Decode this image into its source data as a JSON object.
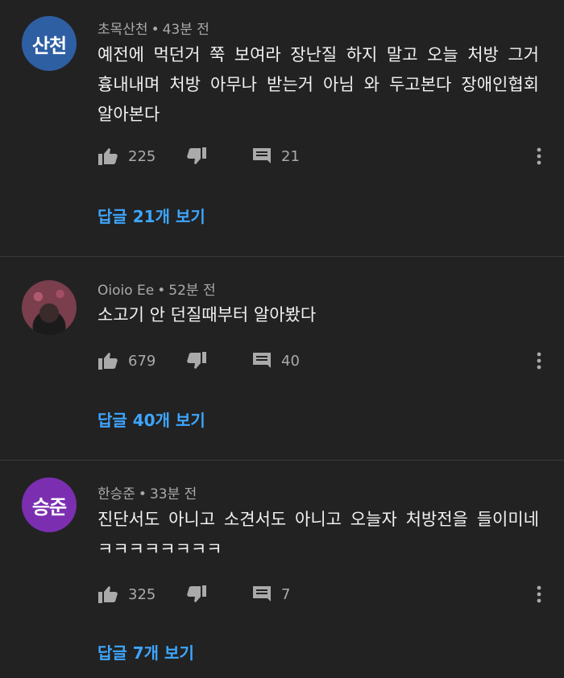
{
  "colors": {
    "background": "#222222",
    "text_primary": "#f1f1f1",
    "text_secondary": "#aaaaaa",
    "link": "#3ea6ff",
    "divider": "#3a3a3a"
  },
  "comments": [
    {
      "avatar_text": "산천",
      "avatar_color": "#2f5fa3",
      "author": "초목산천",
      "separator": "•",
      "time": "43분 전",
      "text": "예전에 먹던거 쭉 보여라 장난질 하지 말고 오늘 처방 그거 흉내내며 처방 아무나 받는거 아님 와 두고본다 장애인협회 알아본다",
      "likes": "225",
      "replies": "21",
      "view_replies": "답글 21개 보기",
      "icons": {
        "like": "thumbs-up-icon",
        "dislike": "thumbs-down-icon",
        "reply": "reply-icon",
        "more": "more-vert-icon"
      }
    },
    {
      "avatar_text": "",
      "avatar_color": "#7a3e4c",
      "author": "Oioio Ee",
      "separator": "•",
      "time": "52분 전",
      "text": "소고기 안 던질때부터 알아봤다",
      "likes": "679",
      "replies": "40",
      "view_replies": "답글 40개 보기",
      "icons": {
        "like": "thumbs-up-icon",
        "dislike": "thumbs-down-icon",
        "reply": "reply-icon",
        "more": "more-vert-icon"
      }
    },
    {
      "avatar_text": "승준",
      "avatar_color": "#7b2fb0",
      "author": "한승준",
      "separator": "•",
      "time": "33분 전",
      "text": "진단서도 아니고 소견서도 아니고 오늘자 처방전을 들이미네 ㅋㅋㅋㅋㅋㅋㅋㅋ",
      "likes": "325",
      "replies": "7",
      "view_replies": "답글 7개 보기",
      "icons": {
        "like": "thumbs-up-icon",
        "dislike": "thumbs-down-icon",
        "reply": "reply-icon",
        "more": "more-vert-icon"
      }
    }
  ]
}
